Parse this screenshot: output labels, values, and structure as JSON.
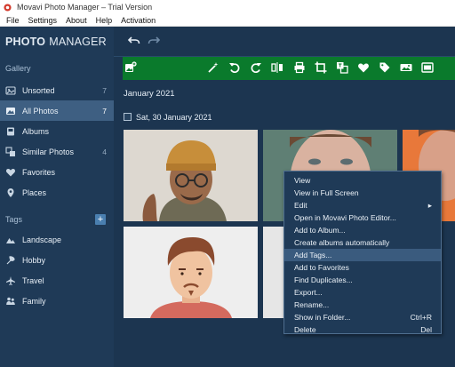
{
  "window": {
    "title": "Movavi Photo Manager – Trial Version"
  },
  "menu": [
    "File",
    "Settings",
    "About",
    "Help",
    "Activation"
  ],
  "brand": {
    "part1": "PHOTO",
    "part2": "MANAGER"
  },
  "sidebar": {
    "gallery_label": "Gallery",
    "items": [
      {
        "label": "Unsorted",
        "count": "7",
        "icon": "unsorted-icon"
      },
      {
        "label": "All Photos",
        "count": "7",
        "icon": "photos-icon",
        "active": true
      },
      {
        "label": "Albums",
        "count": "",
        "icon": "albums-icon"
      },
      {
        "label": "Similar Photos",
        "count": "4",
        "icon": "similar-icon"
      },
      {
        "label": "Favorites",
        "count": "",
        "icon": "heart-icon"
      },
      {
        "label": "Places",
        "count": "",
        "icon": "location-pin-icon"
      }
    ],
    "tags_label": "Tags",
    "add_tag_symbol": "+",
    "tags": [
      {
        "label": "Landscape",
        "icon": "landscape-icon"
      },
      {
        "label": "Hobby",
        "icon": "hobby-icon"
      },
      {
        "label": "Travel",
        "icon": "airplane-icon"
      },
      {
        "label": "Family",
        "icon": "family-icon"
      }
    ]
  },
  "toolbar_icons": [
    "add-photos-icon",
    "magic-wand-icon",
    "rotate-left-icon",
    "rotate-right-icon",
    "flip-icon",
    "print-icon",
    "crop-icon",
    "translate-icon",
    "favorite-heart-icon",
    "tag-icon",
    "slideshow-icon",
    "more-icon"
  ],
  "content": {
    "month": "January 2021",
    "day": "Sat, 30 January 2021"
  },
  "context_menu": [
    {
      "label": "View",
      "shortcut": ""
    },
    {
      "label": "View in Full Screen",
      "shortcut": ""
    },
    {
      "label": "Edit",
      "shortcut": "",
      "submenu": true
    },
    {
      "label": "Open in Movavi Photo Editor...",
      "shortcut": ""
    },
    {
      "label": "Add to Album...",
      "shortcut": ""
    },
    {
      "label": "Create albums automatically",
      "shortcut": ""
    },
    {
      "label": "Add Tags...",
      "shortcut": "",
      "highlighted": true
    },
    {
      "label": "Add to Favorites",
      "shortcut": ""
    },
    {
      "label": "Find Duplicates...",
      "shortcut": ""
    },
    {
      "label": "Export...",
      "shortcut": ""
    },
    {
      "label": "Rename...",
      "shortcut": ""
    },
    {
      "label": "Show in Folder...",
      "shortcut": "Ctrl+R"
    },
    {
      "label": "Delete",
      "shortcut": "Del"
    }
  ],
  "colors": {
    "sidebar_bg": "#1f3a57",
    "toolbar_green": "#0a7a2c",
    "active_item": "#3e5f82",
    "accent": "#4a7fb0"
  }
}
